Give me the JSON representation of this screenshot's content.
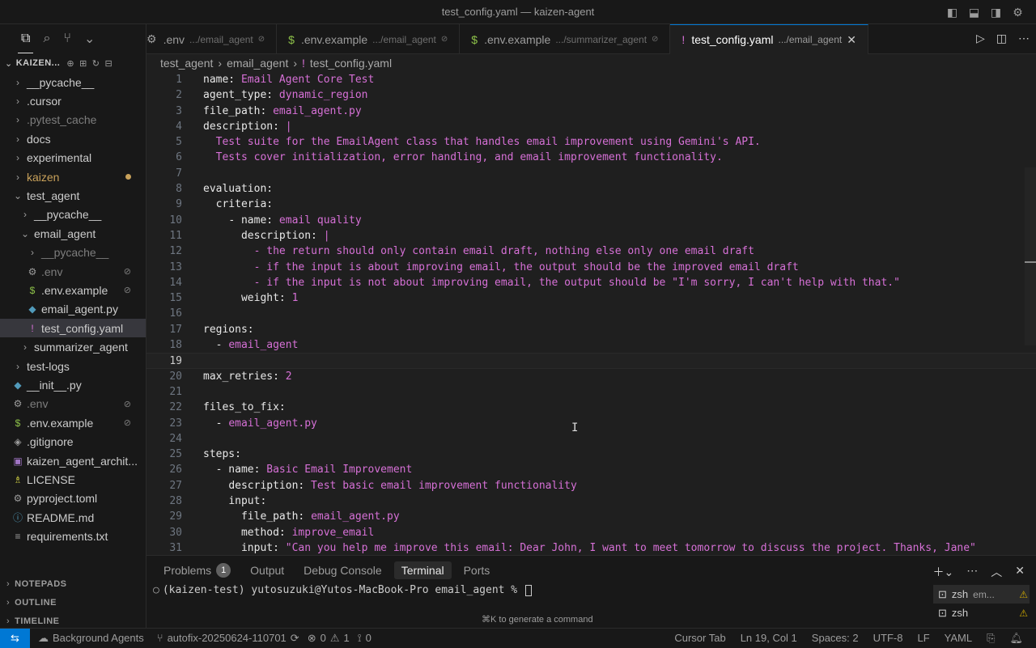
{
  "window": {
    "title": "test_config.yaml — kaizen-agent"
  },
  "explorer": {
    "header": "KAIZEN...",
    "items": [
      {
        "label": "__pycache__",
        "icon": "chevron-right",
        "indent": 1,
        "dim": false
      },
      {
        "label": ".cursor",
        "icon": "chevron-right",
        "indent": 1,
        "dim": false
      },
      {
        "label": ".pytest_cache",
        "icon": "chevron-right",
        "indent": 1,
        "dim": true
      },
      {
        "label": "docs",
        "icon": "chevron-right",
        "indent": 1,
        "dim": false
      },
      {
        "label": "experimental",
        "icon": "chevron-right",
        "indent": 1,
        "dim": false
      },
      {
        "label": "kaizen",
        "icon": "chevron-right",
        "indent": 1,
        "dim": false
      },
      {
        "label": "test_agent",
        "icon": "chevron-down",
        "indent": 1,
        "dim": false
      },
      {
        "label": "__pycache__",
        "icon": "chevron-right",
        "indent": 2,
        "dim": false
      },
      {
        "label": "email_agent",
        "icon": "chevron-down",
        "indent": 2,
        "dim": false
      },
      {
        "label": "__pycache__",
        "icon": "chevron-right",
        "indent": 3,
        "dim": true
      },
      {
        "label": ".env",
        "icon": "gear",
        "indent": 3,
        "dim": true
      },
      {
        "label": ".env.example",
        "icon": "dollar",
        "indent": 3,
        "dim": false
      },
      {
        "label": "email_agent.py",
        "icon": "python",
        "indent": 3,
        "dim": false
      },
      {
        "label": "test_config.yaml",
        "icon": "exclamation",
        "indent": 3,
        "dim": false
      },
      {
        "label": "summarizer_agent",
        "icon": "chevron-right",
        "indent": 2,
        "dim": false
      },
      {
        "label": "test-logs",
        "icon": "chevron-right",
        "indent": 1,
        "dim": false
      },
      {
        "label": "__init__.py",
        "icon": "python",
        "indent": 1,
        "dim": false
      },
      {
        "label": ".env",
        "icon": "gear",
        "indent": 1,
        "dim": true
      },
      {
        "label": ".env.example",
        "icon": "dollar",
        "indent": 1,
        "dim": false
      },
      {
        "label": ".gitignore",
        "icon": "git",
        "indent": 1,
        "dim": false
      },
      {
        "label": "kaizen_agent_archit...",
        "icon": "image",
        "indent": 1,
        "dim": false
      },
      {
        "label": "LICENSE",
        "icon": "license",
        "indent": 1,
        "dim": false
      },
      {
        "label": "pyproject.toml",
        "icon": "gear",
        "indent": 1,
        "dim": false
      },
      {
        "label": "README.md",
        "icon": "info",
        "indent": 1,
        "dim": false
      },
      {
        "label": "requirements.txt",
        "icon": "lines",
        "indent": 1,
        "dim": false
      }
    ],
    "sections": [
      "NOTEPADS",
      "OUTLINE",
      "TIMELINE"
    ]
  },
  "tabs": [
    {
      "name": ".env",
      "path": ".../email_agent",
      "icon": "gear"
    },
    {
      "name": ".env.example",
      "path": ".../email_agent",
      "icon": "dollar"
    },
    {
      "name": ".env.example",
      "path": ".../summarizer_agent",
      "icon": "dollar"
    },
    {
      "name": "test_config.yaml",
      "path": ".../email_agent",
      "icon": "exclamation",
      "active": true
    }
  ],
  "breadcrumb": [
    "test_agent",
    "email_agent",
    "test_config.yaml"
  ],
  "editor": {
    "current_line": 19,
    "lines": [
      {
        "n": "1",
        "k": "name:",
        "v": " Email Agent Core Test",
        "ind": ""
      },
      {
        "n": "2",
        "k": "agent_type:",
        "v": " dynamic_region",
        "ind": ""
      },
      {
        "n": "3",
        "k": "file_path:",
        "v": " email_agent.py",
        "ind": ""
      },
      {
        "n": "4",
        "k": "description:",
        "v": " |",
        "ind": ""
      },
      {
        "n": "5",
        "k": "",
        "v": "Test suite for the EmailAgent class that handles email improvement using Gemini's API.",
        "ind": "  "
      },
      {
        "n": "6",
        "k": "",
        "v": "Tests cover initialization, error handling, and email improvement functionality.",
        "ind": "  "
      },
      {
        "n": "7",
        "k": "",
        "v": "",
        "ind": ""
      },
      {
        "n": "8",
        "k": "evaluation:",
        "v": "",
        "ind": ""
      },
      {
        "n": "9",
        "k": "criteria:",
        "v": "",
        "ind": "  "
      },
      {
        "n": "10",
        "k": "- name:",
        "v": " email quality",
        "ind": "    "
      },
      {
        "n": "11",
        "k": "description:",
        "v": " |",
        "ind": "      "
      },
      {
        "n": "12",
        "k": "",
        "v": "- the return should only contain email draft, nothing else only one email draft",
        "ind": "        "
      },
      {
        "n": "13",
        "k": "",
        "v": "- if the input is about improving email, the output should be the improved email draft",
        "ind": "        "
      },
      {
        "n": "14",
        "k": "",
        "v": "- if the input is not about improving email, the output should be \"I'm sorry, I can't help with that.\"",
        "ind": "        "
      },
      {
        "n": "15",
        "k": "weight:",
        "v": " 1",
        "ind": "      "
      },
      {
        "n": "16",
        "k": "",
        "v": "",
        "ind": ""
      },
      {
        "n": "17",
        "k": "regions:",
        "v": "",
        "ind": ""
      },
      {
        "n": "18",
        "k": "- ",
        "v": "email_agent",
        "ind": "  "
      },
      {
        "n": "19",
        "k": "",
        "v": "",
        "ind": ""
      },
      {
        "n": "20",
        "k": "max_retries:",
        "v": " 2",
        "ind": ""
      },
      {
        "n": "21",
        "k": "",
        "v": "",
        "ind": ""
      },
      {
        "n": "22",
        "k": "files_to_fix:",
        "v": "",
        "ind": ""
      },
      {
        "n": "23",
        "k": "- ",
        "v": "email_agent.py",
        "ind": "  "
      },
      {
        "n": "24",
        "k": "",
        "v": "",
        "ind": ""
      },
      {
        "n": "25",
        "k": "steps:",
        "v": "",
        "ind": ""
      },
      {
        "n": "26",
        "k": "- name:",
        "v": " Basic Email Improvement",
        "ind": "  "
      },
      {
        "n": "27",
        "k": "description:",
        "v": " Test basic email improvement functionality",
        "ind": "    "
      },
      {
        "n": "28",
        "k": "input:",
        "v": "",
        "ind": "    "
      },
      {
        "n": "29",
        "k": "file_path:",
        "v": " email_agent.py",
        "ind": "      "
      },
      {
        "n": "30",
        "k": "method:",
        "v": " improve_email",
        "ind": "      "
      },
      {
        "n": "31",
        "k": "input:",
        "v": " \"Can you help me improve this email: Dear John, I want to meet tomorrow to discuss the project. Thanks, Jane\"",
        "ind": "      "
      }
    ]
  },
  "panel": {
    "tabs": [
      "Problems",
      "Output",
      "Debug Console",
      "Terminal",
      "Ports"
    ],
    "problems_count": "1",
    "active_tab": "Terminal",
    "prompt": "(kaizen-test) yutosuzuki@Yutos-MacBook-Pro email_agent % ",
    "hint": "⌘K to generate a command",
    "sessions": [
      {
        "label": "zsh",
        "sub": "em...",
        "warn": true
      },
      {
        "label": "zsh",
        "sub": "",
        "warn": true
      }
    ]
  },
  "status": {
    "agents": "Background Agents",
    "branch": "autofix-20250624-110701",
    "errors": "0",
    "warnings": "1",
    "ports": "0",
    "cursor_tab": "Cursor Tab",
    "position": "Ln 19, Col 1",
    "spaces": "Spaces: 2",
    "encoding": "UTF-8",
    "eol": "LF",
    "language": "YAML"
  },
  "colors": {
    "accent": "#0078d4",
    "yaml_value": "#d670d6",
    "modified_dot": "#c8a15a",
    "warning": "#cca700"
  }
}
